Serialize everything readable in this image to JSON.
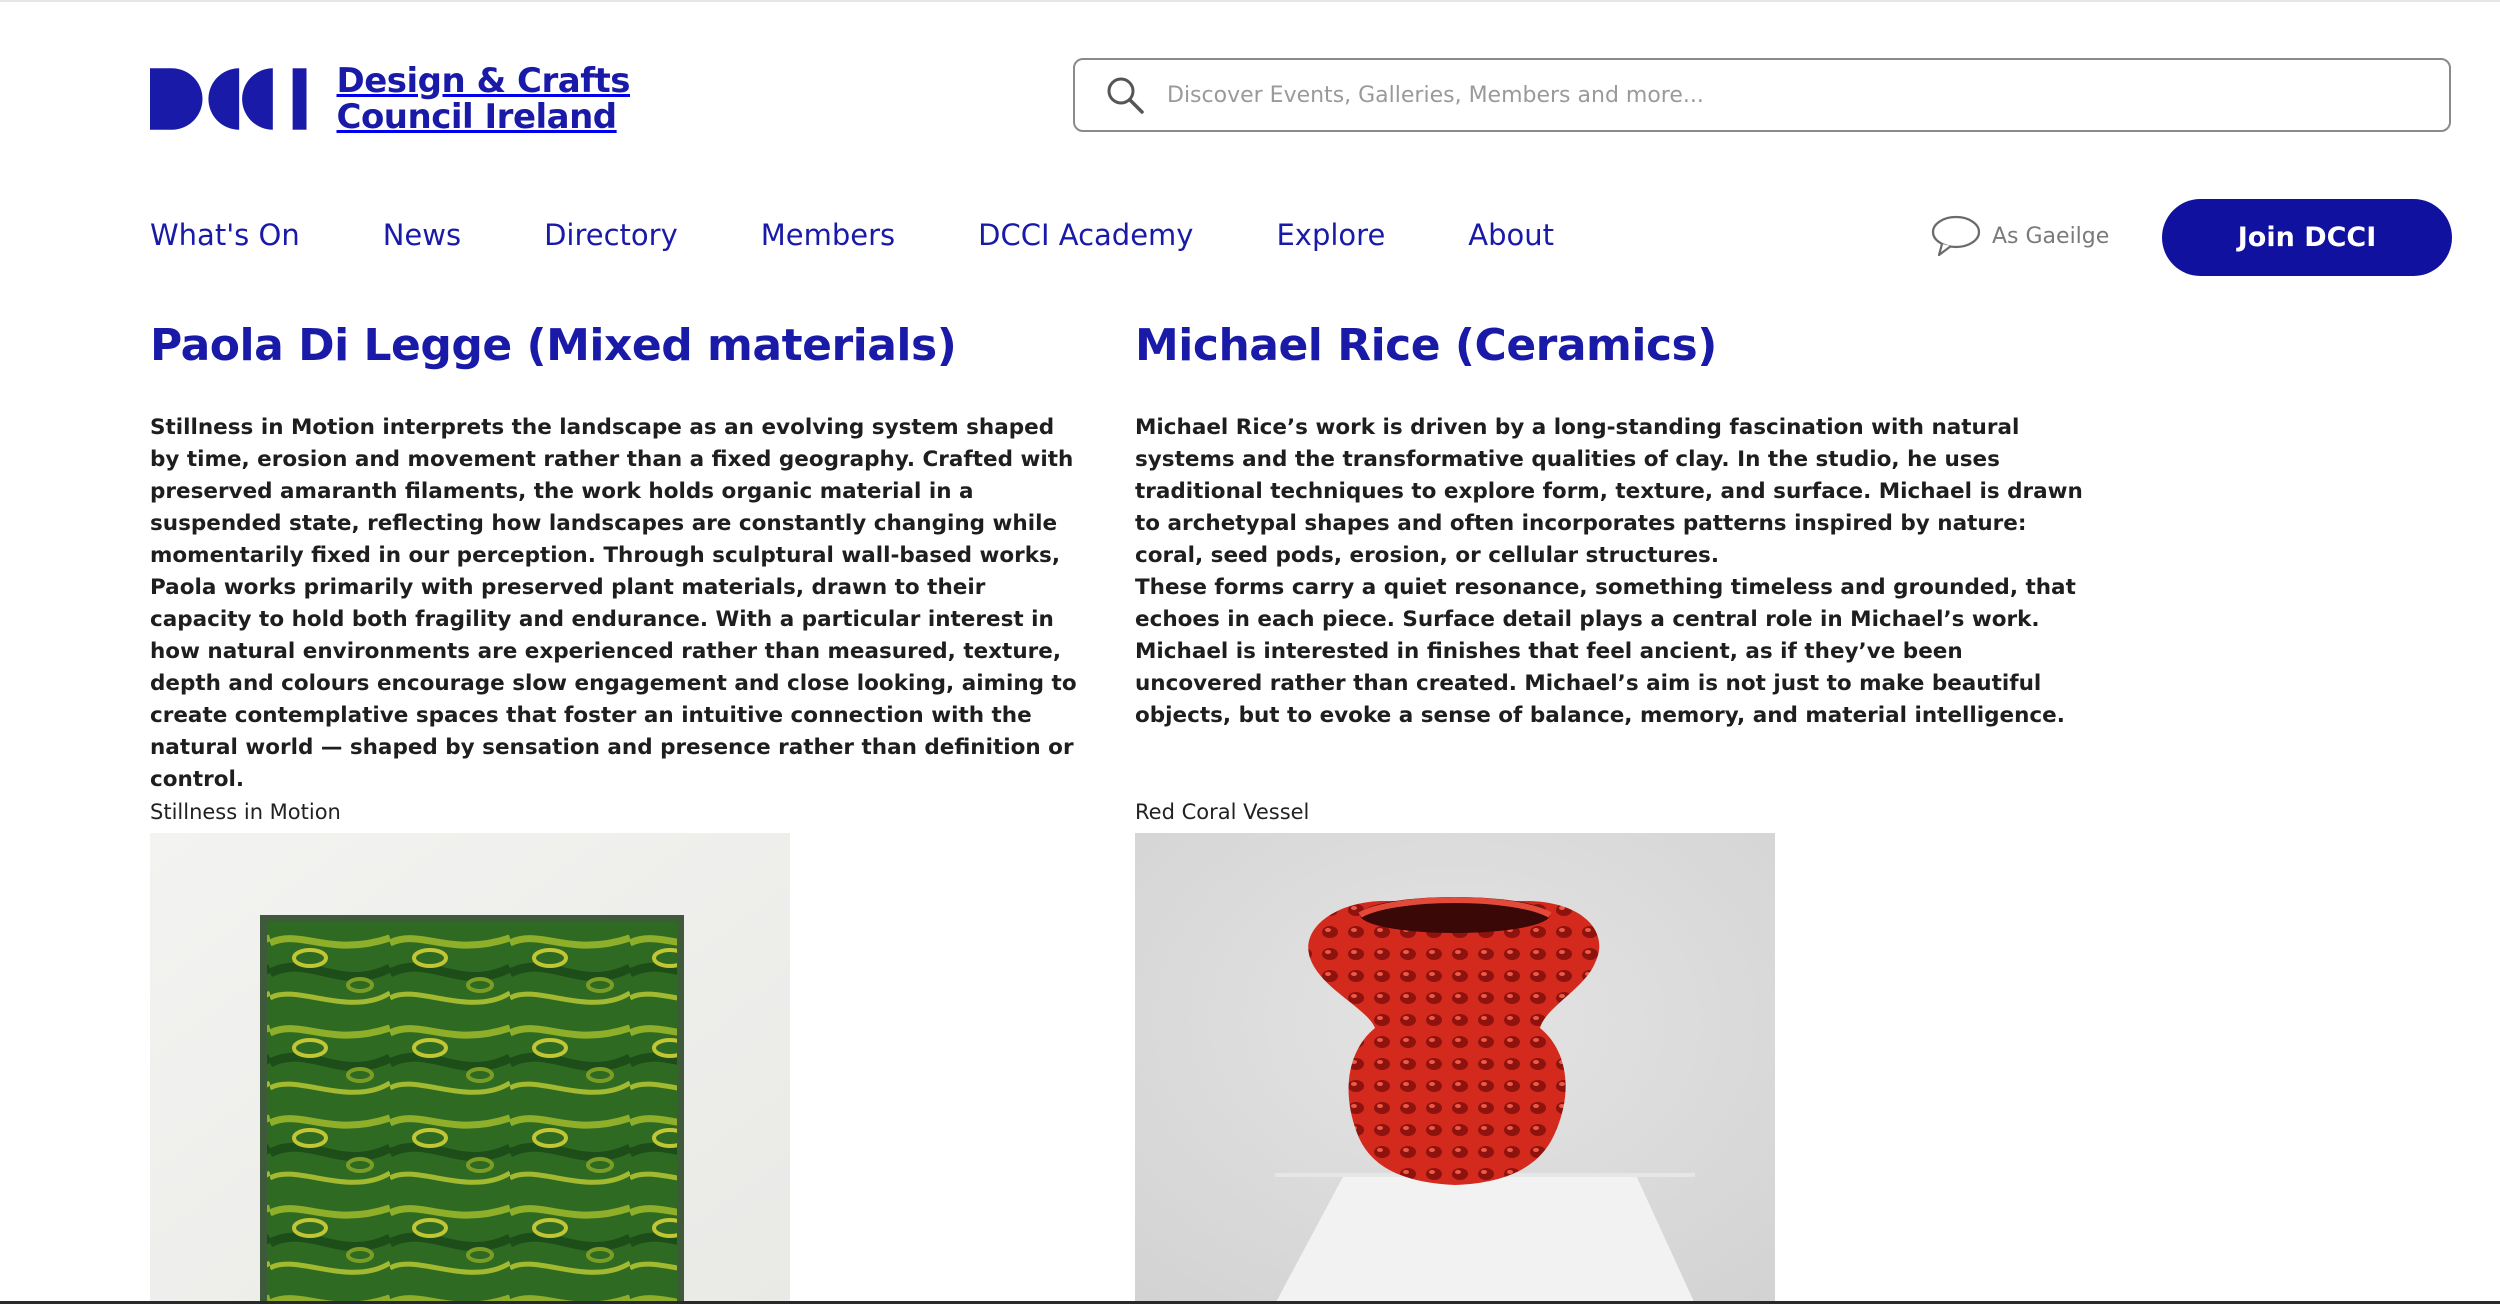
{
  "brand": {
    "logo_mark": "DCCI",
    "name_line1": "Design & Crafts",
    "name_line2": "Council Ireland",
    "accent": "#1a1aa8",
    "button_color": "#1111a0"
  },
  "search": {
    "placeholder": "Discover Events, Galleries, Members and more...",
    "icon": "search-icon"
  },
  "nav": {
    "items": [
      {
        "label": "What's On"
      },
      {
        "label": "News"
      },
      {
        "label": "Directory"
      },
      {
        "label": "Members"
      },
      {
        "label": "DCCI Academy"
      },
      {
        "label": "Explore"
      },
      {
        "label": "About"
      }
    ],
    "language": {
      "label": "As Gaeilge",
      "icon": "speech-bubble-icon"
    },
    "join_label": "Join DCCI"
  },
  "makers": [
    {
      "title": "Paola Di Legge (Mixed materials)",
      "paragraphs": [
        "Stillness in Motion interprets the landscape as an evolving system shaped by time, erosion and movement rather than a fixed geography. Crafted with preserved amaranth filaments, the work holds organic material in a suspended state, reflecting how landscapes are constantly changing while momentarily fixed in our perception. Through sculptural wall-based works, Paola works primarily with preserved plant materials, drawn to their capacity to hold both fragility and endurance. With a particular interest in how natural environments are experienced rather than measured, texture, depth and colours encourage slow engagement and close looking, aiming to create contemplative spaces that foster an intuitive connection with the natural world — shaped by sensation and presence rather than definition or control."
      ],
      "work_caption": "Stillness in Motion"
    },
    {
      "title": "Michael Rice (Ceramics)",
      "paragraphs": [
        "Michael Rice’s work is driven by a long-standing fascination with natural systems and the transformative qualities of clay. In the studio, he uses traditional techniques to explore form, texture, and surface. Michael is drawn to archetypal shapes and often incorporates patterns inspired by nature: coral, seed pods, erosion, or cellular structures.",
        "These forms carry a quiet resonance, something timeless and grounded, that echoes in each piece. Surface detail plays a central role in Michael’s work. Michael is interested in finishes that feel ancient, as if they’ve been uncovered rather than created. Michael’s aim is not just to make beautiful objects, but to evoke a sense of balance, memory, and material intelligence."
      ],
      "work_caption": "Red Coral Vessel"
    }
  ]
}
